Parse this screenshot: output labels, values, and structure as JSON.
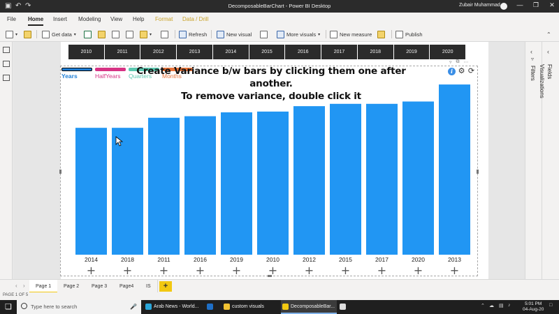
{
  "titlebar": {
    "title": "DecomposableBarChart - Power BI Desktop",
    "user": "Zubair Muhammad",
    "save_icon": "save-icon",
    "undo_icon": "undo-icon",
    "redo_icon": "redo-icon"
  },
  "menu": [
    "File",
    "Home",
    "Insert",
    "Modeling",
    "View",
    "Help",
    "Format",
    "Data / Drill"
  ],
  "ribbon": {
    "get_data": "Get data",
    "refresh": "Refresh",
    "new_visual": "New visual",
    "more_visuals": "More visuals",
    "new_measure": "New measure",
    "publish": "Publish"
  },
  "slicer": [
    "2010",
    "2011",
    "2012",
    "2013",
    "2014",
    "2015",
    "2016",
    "2017",
    "2018",
    "2019",
    "2020"
  ],
  "legend": [
    {
      "label": "Years",
      "color": "#1f7fd6",
      "active": true
    },
    {
      "label": "HalfYears",
      "color": "#d63384"
    },
    {
      "label": "Quarters",
      "color": "#5cc8b0"
    },
    {
      "label": "Months",
      "color": "#e8743b"
    }
  ],
  "instruction": {
    "line1": "Create Variance b/w bars by clicking them one after another.",
    "line2": "To remove variance, double click it"
  },
  "chart_data": {
    "type": "bar",
    "categories": [
      "2014",
      "2018",
      "2011",
      "2016",
      "2019",
      "2010",
      "2012",
      "2015",
      "2017",
      "2020",
      "2013"
    ],
    "values": [
      164,
      164,
      177,
      179,
      184,
      185,
      192,
      195,
      195,
      198,
      220
    ],
    "ylim": [
      0,
      230
    ],
    "bar_color": "#2196f3",
    "grid": false,
    "drill_icon": "plus-icon"
  },
  "right_panes": {
    "filters": "Filters",
    "visualizations": "Visualizations",
    "fields": "Fields"
  },
  "tabs": [
    "Page 1",
    "Page 2",
    "Page 3",
    "Page4",
    "IS"
  ],
  "status": "PAGE 1 OF 5",
  "taskbar": {
    "search_placeholder": "Type here to search",
    "items": [
      "Arab News - World...",
      "",
      "custom visuals",
      "DecomposableBar...",
      ""
    ],
    "time": "5:01 PM",
    "date": "04-Aug-20"
  }
}
